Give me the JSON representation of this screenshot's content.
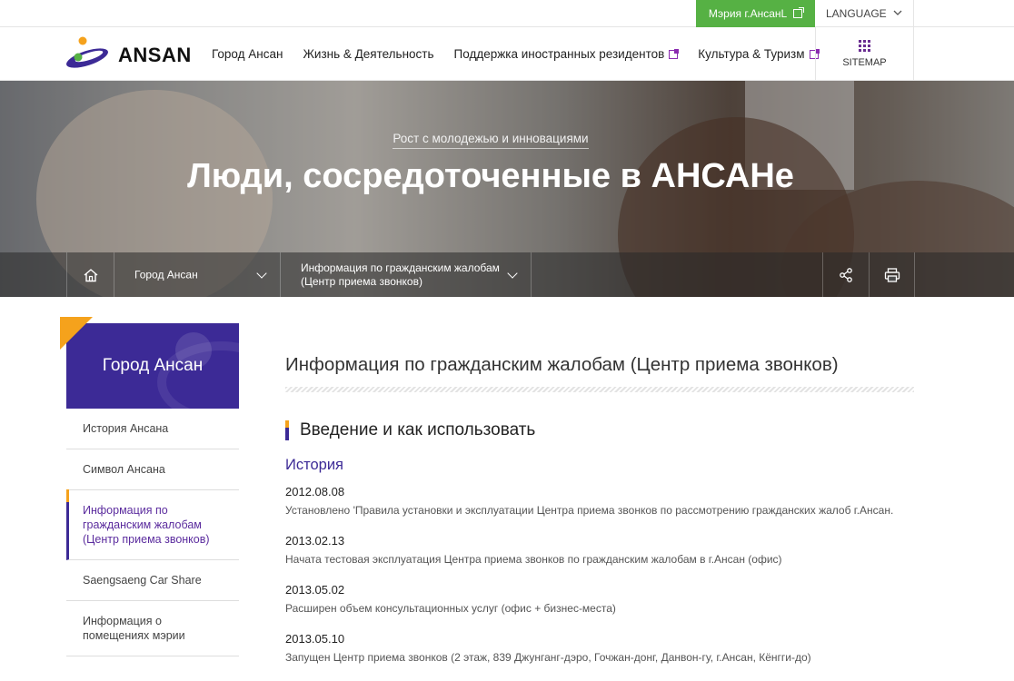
{
  "topbar": {
    "mayor_label": "Мэрия г.АнсанL",
    "language_label": "LANGUAGE"
  },
  "header": {
    "logo_text": "ANSAN",
    "nav": [
      {
        "label": "Город Ансан"
      },
      {
        "label": "Жизнь & Деятельность"
      },
      {
        "label": "Поддержка иностранных резидентов"
      },
      {
        "label": "Культура & Туризм"
      }
    ],
    "sitemap_label": "SITEMAP"
  },
  "hero": {
    "subtitle": "Рост с молодежью и инновациями",
    "title": "Люди, сосредоточенные в АНСАНе"
  },
  "location": {
    "level1": "Город Ансан",
    "level2": "Информация по гражданским жалобам (Центр приема звонков)"
  },
  "sidebar": {
    "title": "Город Ансан",
    "items": [
      {
        "label": "История Ансана"
      },
      {
        "label": "Символ Ансана"
      },
      {
        "label": "Информация по гражданским жалобам (Центр приема звонков)"
      },
      {
        "label": "Saengsaeng Car Share"
      },
      {
        "label": "Информация о помещениях мэрии"
      }
    ]
  },
  "main": {
    "page_title": "Информация по гражданским жалобам (Центр приема звонков)",
    "section_title": "Введение и как использовать",
    "history_title": "История",
    "history": [
      {
        "date": "2012.08.08",
        "text": "Установлено 'Правила установки и эксплуатации Центра приема звонков по рассмотрению гражданских жалоб г.Ансан."
      },
      {
        "date": "2013.02.13",
        "text": "Начата тестовая эксплуатация Центра приема звонков по гражданским жалобам в г.Ансан (офис)"
      },
      {
        "date": "2013.05.02",
        "text": "Расширен объем консультационных услуг (офис + бизнес-места)"
      },
      {
        "date": "2013.05.10",
        "text": "Запущен Центр приема звонков (2 этаж, 839 Джунганг-дэро, Гочжан-донг, Данвон-гу, г.Ансан, Кёнгги-до)"
      }
    ]
  },
  "colors": {
    "brand_purple": "#3c2a96",
    "accent_orange": "#f5a21c",
    "mayor_green": "#56b144"
  }
}
